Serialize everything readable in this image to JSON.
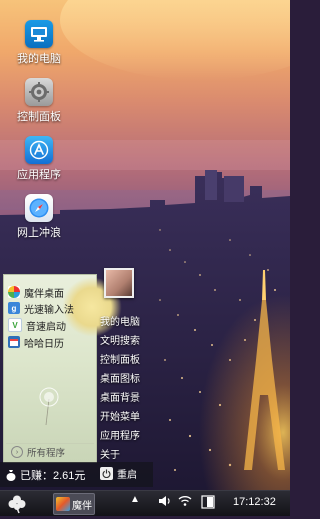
{
  "desktop": {
    "icons": [
      {
        "label": "我的电脑",
        "icon": "computer-icon"
      },
      {
        "label": "控制面板",
        "icon": "settings-icon"
      },
      {
        "label": "应用程序",
        "icon": "app-store-icon"
      },
      {
        "label": "网上冲浪",
        "icon": "compass-icon"
      }
    ]
  },
  "start_menu": {
    "programs": [
      {
        "label": "魔伴桌面",
        "icon": "pinwheel-icon",
        "color": "#e55"
      },
      {
        "label": "光速输入法",
        "icon": "g-input-icon",
        "color": "#3a86d9"
      },
      {
        "label": "音速启动",
        "icon": "v-launch-icon",
        "color": "#4caf50"
      },
      {
        "label": "哈哈日历",
        "icon": "calendar-icon",
        "color": "#2f6fb8"
      }
    ],
    "all_programs": "所有程序",
    "links": [
      "我的电脑",
      "文明搜索",
      "控制面板",
      "桌面图标",
      "桌面背景",
      "开始菜单",
      "应用程序",
      "关于"
    ],
    "earnings": "已赚：2.61元",
    "reboot": "重启"
  },
  "taskbar": {
    "task_label": "魔伴",
    "clock": "17:12:32"
  }
}
